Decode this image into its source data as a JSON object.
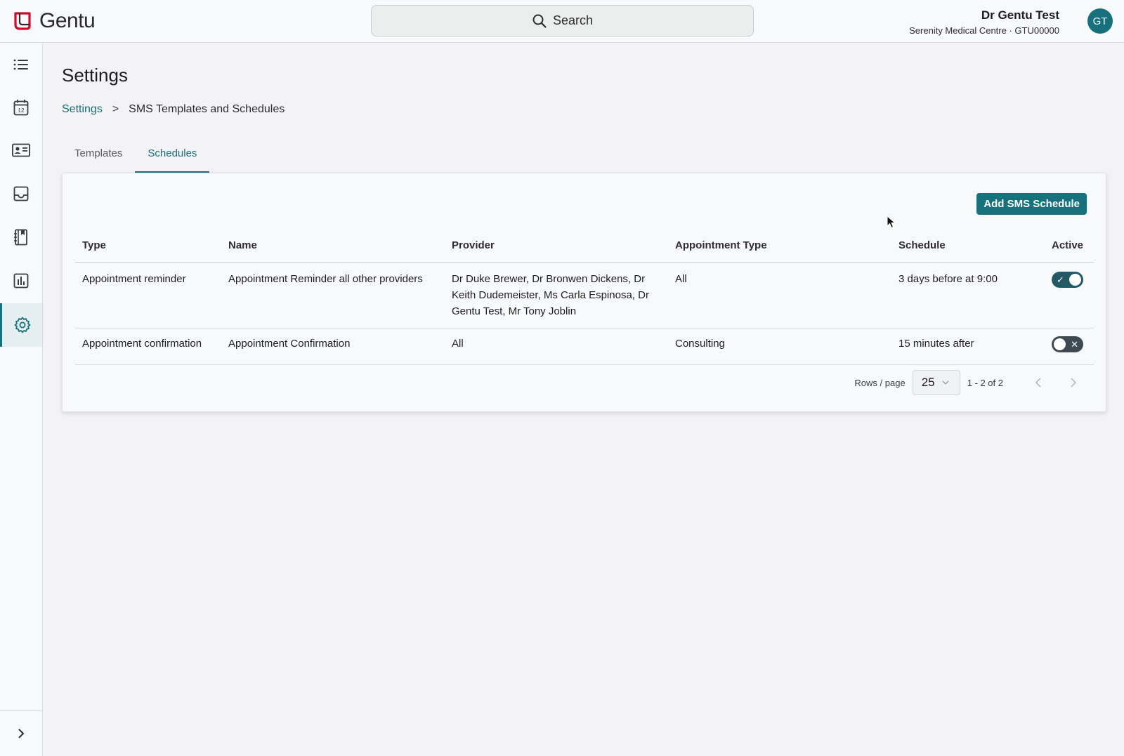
{
  "app": {
    "name": "Gentu",
    "search_label": "Search"
  },
  "user": {
    "name": "Dr Gentu Test",
    "org": "Serenity Medical Centre · GTU00000",
    "initials": "GT"
  },
  "sidebar": {
    "items": [
      {
        "icon": "list-icon"
      },
      {
        "icon": "calendar-icon",
        "badge": "12"
      },
      {
        "icon": "contact-card-icon"
      },
      {
        "icon": "inbox-icon"
      },
      {
        "icon": "notebook-icon"
      },
      {
        "icon": "bar-chart-icon"
      },
      {
        "icon": "gear-icon",
        "active": true
      }
    ],
    "expand_icon": "chevron-right-icon"
  },
  "page": {
    "title": "Settings",
    "breadcrumb": {
      "link": "Settings",
      "separator": ">",
      "current": "SMS Templates and Schedules"
    },
    "tabs": [
      {
        "label": "Templates",
        "active": false
      },
      {
        "label": "Schedules",
        "active": true
      }
    ]
  },
  "schedules": {
    "add_button": "Add SMS Schedule",
    "columns": [
      "Type",
      "Name",
      "Provider",
      "Appointment Type",
      "Schedule",
      "Active"
    ],
    "rows": [
      {
        "type": "Appointment reminder",
        "name": "Appointment Reminder all other providers",
        "provider": "Dr Duke Brewer, Dr Bronwen Dickens, Dr Keith Dudemeister, Ms Carla Espinosa, Dr Gentu Test, Mr Tony Joblin",
        "appointment_type": "All",
        "schedule": "3 days before at 9:00",
        "active": true,
        "active_glyph": "✓"
      },
      {
        "type": "Appointment confirmation",
        "name": "Appointment Confirmation",
        "provider": "All",
        "appointment_type": "Consulting",
        "schedule": "15 minutes after",
        "active": false,
        "active_glyph": "✕"
      }
    ],
    "pagination": {
      "rows_label": "Rows / page",
      "rows_per_page": "25",
      "range": "1 - 2 of 2"
    }
  },
  "colors": {
    "accent": "#16717d",
    "toggle_on": "#235a66",
    "toggle_off": "#3e4a52",
    "logo_red": "#c8102e"
  }
}
